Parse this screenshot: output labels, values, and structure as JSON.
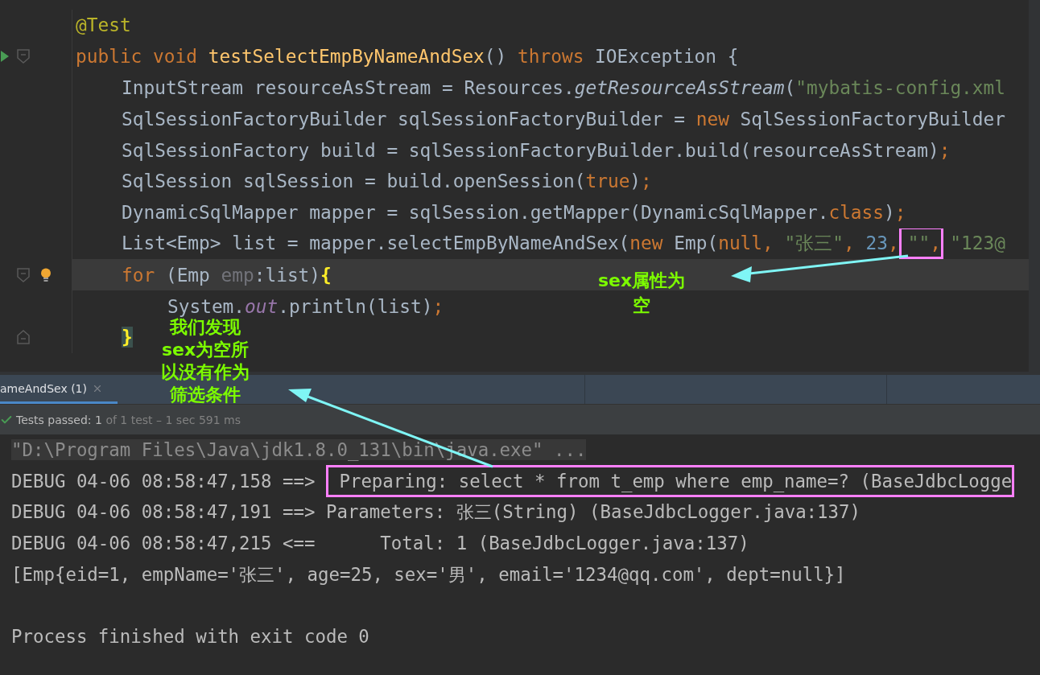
{
  "editor": {
    "lines": [
      {
        "current": false,
        "tokens": [
          {
            "kind": "annotation",
            "text": "@Test"
          }
        ]
      },
      {
        "current": false,
        "gutter": [
          {
            "kind": "run"
          },
          {
            "kind": "fold-start"
          }
        ],
        "tokens": [
          {
            "kind": "keyword",
            "text": "public void "
          },
          {
            "kind": "method",
            "text": "testSelectEmpByNameAndSex"
          },
          {
            "kind": "plain",
            "text": "() "
          },
          {
            "kind": "keyword",
            "text": "throws "
          },
          {
            "kind": "plain",
            "text": "IOException {"
          }
        ],
        "children": [
          {
            "current": false,
            "tokens": [
              {
                "kind": "plain",
                "text": "InputStream resourceAsStream = Resources."
              },
              {
                "kind": "static",
                "text": "getResourceAsStream"
              },
              {
                "kind": "plain",
                "text": "("
              },
              {
                "kind": "string",
                "text": "\"mybatis-config.xml"
              }
            ]
          },
          {
            "current": false,
            "tokens": [
              {
                "kind": "plain",
                "text": "SqlSessionFactoryBuilder sqlSessionFactoryBuilder = "
              },
              {
                "kind": "keyword",
                "text": "new "
              },
              {
                "kind": "plain",
                "text": "SqlSessionFactoryBuilder"
              }
            ]
          },
          {
            "current": false,
            "tokens": [
              {
                "kind": "plain",
                "text": "SqlSessionFactory build = sqlSessionFactoryBuilder.build(resourceAsStream)"
              },
              {
                "kind": "keyword",
                "text": ";"
              }
            ]
          },
          {
            "current": false,
            "tokens": [
              {
                "kind": "plain",
                "text": "SqlSession sqlSession = build.openSession("
              },
              {
                "kind": "keyword",
                "text": "true"
              },
              {
                "kind": "plain",
                "text": ")"
              },
              {
                "kind": "keyword",
                "text": ";"
              }
            ]
          },
          {
            "current": false,
            "tokens": [
              {
                "kind": "plain",
                "text": "DynamicSqlMapper mapper = sqlSession.getMapper(DynamicSqlMapper."
              },
              {
                "kind": "keyword",
                "text": "class"
              },
              {
                "kind": "plain",
                "text": ")"
              },
              {
                "kind": "keyword",
                "text": ";"
              }
            ]
          },
          {
            "current": false,
            "tokens": [
              {
                "kind": "plain",
                "text": "List<Emp> list = mapper.selectEmpByNameAndSex("
              },
              {
                "kind": "keyword",
                "text": "new "
              },
              {
                "kind": "plain",
                "text": "Emp("
              },
              {
                "kind": "keyword",
                "text": "null, "
              },
              {
                "kind": "string",
                "text": "\"张三\""
              },
              {
                "kind": "keyword",
                "text": ", "
              },
              {
                "kind": "number",
                "text": "23"
              },
              {
                "kind": "keyword",
                "text": ","
              },
              {
                "kind": "marked",
                "children": [
                  {
                    "kind": "string",
                    "text": "\"\""
                  },
                  {
                    "kind": "keyword",
                    "text": ","
                  }
                ]
              },
              {
                "kind": "string",
                "text": "\"123@"
              }
            ]
          },
          {
            "current": true,
            "gutter": [
              {
                "kind": "fold-start"
              },
              {
                "kind": "bulb"
              }
            ],
            "tokens": [
              {
                "kind": "keyword",
                "text": "for "
              },
              {
                "kind": "plain",
                "text": "(Emp "
              },
              {
                "kind": "unused",
                "text": "emp"
              },
              {
                "kind": "plain",
                "text": ":list)"
              },
              {
                "kind": "brace",
                "text": "{"
              }
            ],
            "children": [
              {
                "current": false,
                "tokens": [
                  {
                    "kind": "plain",
                    "text": "System."
                  },
                  {
                    "kind": "field",
                    "text": "out"
                  },
                  {
                    "kind": "plain",
                    "text": ".println(list)"
                  },
                  {
                    "kind": "keyword",
                    "text": ";"
                  }
                ]
              }
            ]
          },
          {
            "current": false,
            "gutter": [
              {
                "kind": "fold-end"
              }
            ],
            "tokens": [
              {
                "kind": "brace-match",
                "text": "}"
              }
            ]
          }
        ]
      }
    ]
  },
  "run_tab": {
    "label": "ameAndSex (1)",
    "selected": true
  },
  "test_status": {
    "label": "Tests passed:",
    "count": "1",
    "detail": "of 1 test – 1 sec 591 ms"
  },
  "console": {
    "lines": [
      {
        "kind": "command",
        "segments": [
          {
            "kind": "text",
            "text": "\"D:\\Program Files\\Java\\jdk1.8.0_131\\bin\\java.exe\" ..."
          }
        ]
      },
      {
        "kind": "output",
        "segments": [
          {
            "kind": "text",
            "text": "DEBUG 04-06 08:58:47,158 ==> "
          },
          {
            "kind": "marked",
            "text": " Preparing: select * from t_emp where emp_name=? (BaseJdbcLogge"
          }
        ]
      },
      {
        "kind": "output",
        "segments": [
          {
            "kind": "text",
            "text": "DEBUG 04-06 08:58:47,191 ==> Parameters: 张三(String) (BaseJdbcLogger.java:137)"
          }
        ]
      },
      {
        "kind": "output",
        "segments": [
          {
            "kind": "text",
            "text": "DEBUG 04-06 08:58:47,215 <==      Total: 1 (BaseJdbcLogger.java:137)"
          }
        ]
      },
      {
        "kind": "output",
        "segments": [
          {
            "kind": "text",
            "text": "[Emp{eid=1, empName='张三', age=25, sex='男', email='1234@qq.com', dept=null}]"
          }
        ]
      },
      {
        "kind": "exit",
        "segments": [
          {
            "kind": "text",
            "text": "Process finished with exit code 0"
          }
        ]
      }
    ]
  },
  "notes": [
    {
      "lines": [
        "sex属性为",
        "空"
      ]
    },
    {
      "lines": [
        "我们发现",
        "sex为空所",
        "以没有作为",
        "筛选条件"
      ]
    }
  ]
}
